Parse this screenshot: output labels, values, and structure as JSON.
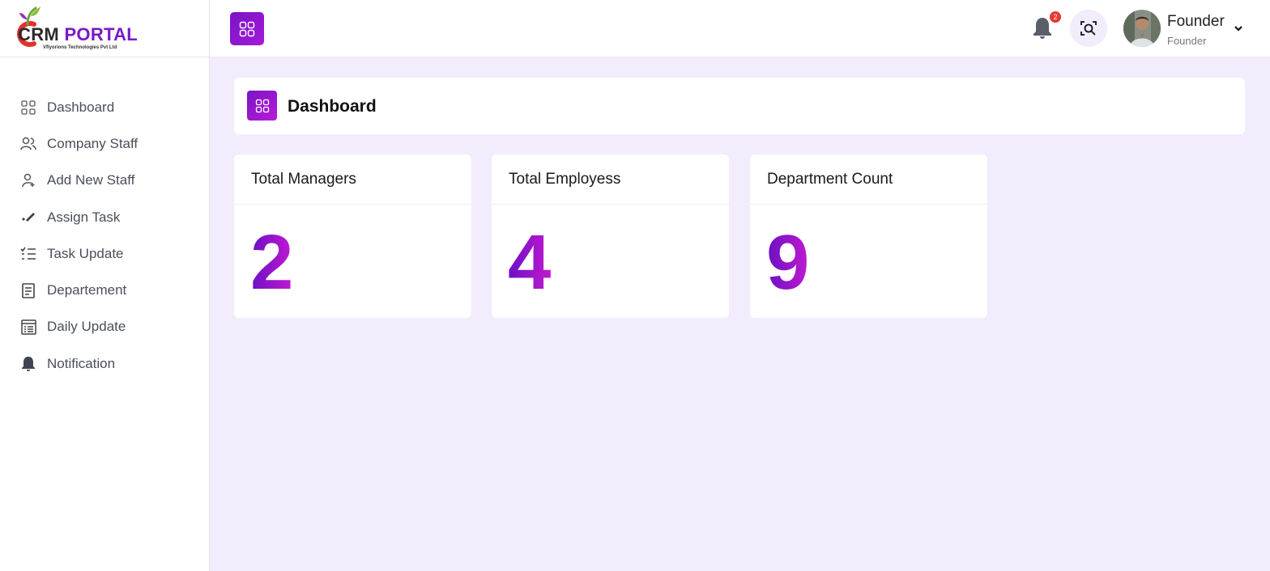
{
  "brand": {
    "logo_primary": "CRM",
    "logo_secondary": "PORTAL",
    "logo_tagline": "Vflyorions Technologies Pvt Ltd",
    "accent_color": "#7a18c8",
    "accent_color_2": "#b61cd8"
  },
  "sidebar": {
    "items": [
      {
        "label": "Dashboard",
        "icon": "grid-icon"
      },
      {
        "label": "Company Staff",
        "icon": "users-icon"
      },
      {
        "label": "Add New Staff",
        "icon": "user-plus-icon"
      },
      {
        "label": "Assign Task",
        "icon": "pen-icon"
      },
      {
        "label": "Task Update",
        "icon": "checklist-icon"
      },
      {
        "label": "Departement",
        "icon": "document-icon"
      },
      {
        "label": "Daily Update",
        "icon": "calendar-list-icon"
      },
      {
        "label": "Notification",
        "icon": "bell-icon"
      }
    ]
  },
  "topbar": {
    "notification_count": "2",
    "user_name": "Founder",
    "user_role": "Founder"
  },
  "page": {
    "title": "Dashboard"
  },
  "stats": [
    {
      "label": "Total Managers",
      "value": "2"
    },
    {
      "label": "Total Employess",
      "value": "4"
    },
    {
      "label": "Department Count",
      "value": "9"
    }
  ]
}
